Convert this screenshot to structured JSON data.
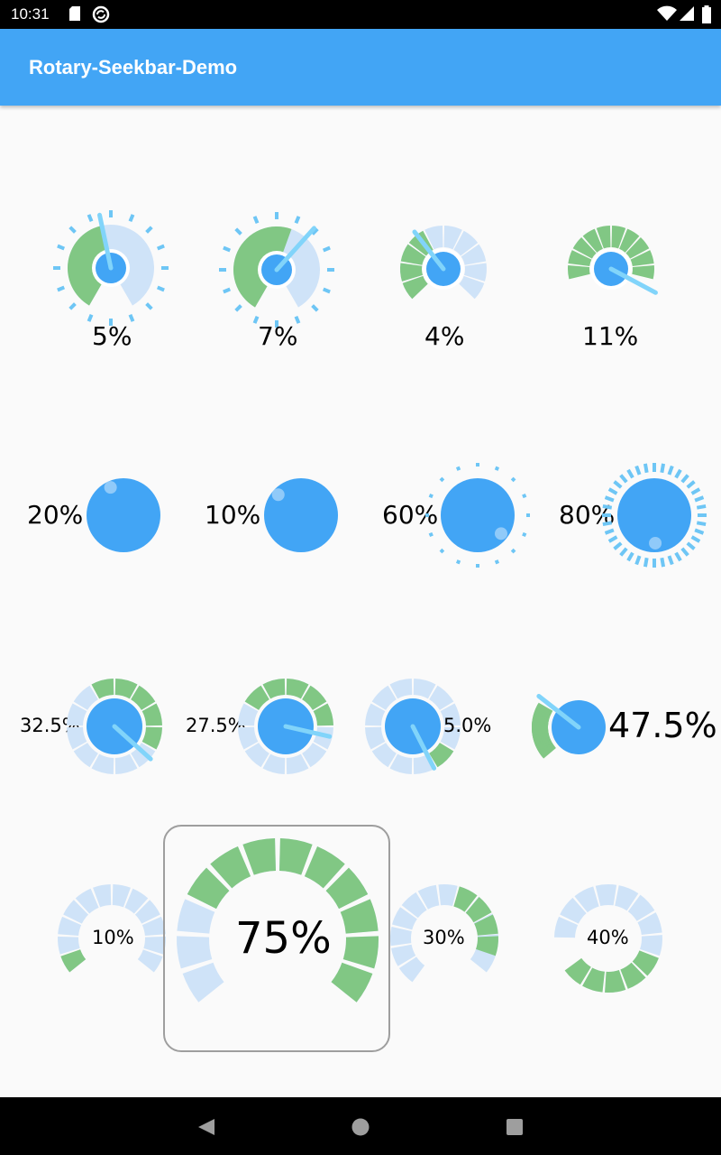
{
  "status_bar": {
    "time": "10:31",
    "left_icons": [
      "sd-card-icon",
      "sync-icon"
    ],
    "right_icons": [
      "wifi-icon",
      "signal-icon",
      "battery-icon"
    ]
  },
  "app_bar": {
    "title": "Rotary-Seekbar-Demo"
  },
  "colors": {
    "app_bar": "#42a5f5",
    "knob": "#42a5f5",
    "progress": "#81c784",
    "track": "#cfe3f8",
    "ticks": "#6ec6f5",
    "pointer": "#81d4fa"
  },
  "knobs": [
    {
      "id": "r1c1",
      "label": "5%",
      "value": 0.05
    },
    {
      "id": "r1c2",
      "label": "7%",
      "value": 0.07
    },
    {
      "id": "r1c3",
      "label": "4%",
      "value": 0.04
    },
    {
      "id": "r1c4",
      "label": "11%",
      "value": 0.11
    },
    {
      "id": "r2c1",
      "label": "20%",
      "value": 0.2
    },
    {
      "id": "r2c2",
      "label": "10%",
      "value": 0.1
    },
    {
      "id": "r2c3",
      "label": "60%",
      "value": 0.6
    },
    {
      "id": "r2c4",
      "label": "80%",
      "value": 0.8
    },
    {
      "id": "r3c1",
      "label": "32.5%",
      "value": 0.325
    },
    {
      "id": "r3c2",
      "label": "27.5%",
      "value": 0.275
    },
    {
      "id": "r3c3",
      "label": "5.0%",
      "value": 0.05
    },
    {
      "id": "r3c4",
      "label": "47.5%",
      "value": 0.475
    },
    {
      "id": "r4c1",
      "label": "10%",
      "value": 0.1
    },
    {
      "id": "r4c2",
      "label": "75%",
      "value": 0.75,
      "selected": true
    },
    {
      "id": "r4c3",
      "label": "30%",
      "value": 0.3
    },
    {
      "id": "r4c4",
      "label": "40%",
      "value": 0.4
    }
  ],
  "nav_bar": {
    "buttons": [
      "back-icon",
      "home-icon",
      "recents-icon"
    ]
  }
}
